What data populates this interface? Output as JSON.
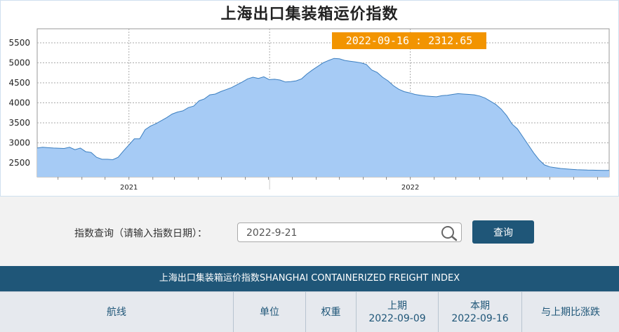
{
  "chart_data": {
    "type": "area",
    "title": "上海出口集装箱运价指数",
    "tooltip": "2022-09-16 : 2312.65",
    "y_ticks": [
      2500,
      3000,
      3500,
      4000,
      4500,
      5000,
      5500
    ],
    "ylim": [
      2150,
      5850
    ],
    "x_tick_labels": [
      "2021",
      "2022"
    ],
    "fill_color": "#a6cbf5",
    "line_color": "#3c7fc0",
    "tooltip_bg": "#f29400",
    "series": [
      {
        "x": [
          "2020-09-04",
          "2020-09-11",
          "2020-09-18",
          "2020-09-25",
          "2020-10-09",
          "2020-10-16",
          "2020-10-23",
          "2020-10-30",
          "2020-11-06",
          "2020-11-13",
          "2020-11-20",
          "2020-11-27",
          "2020-12-04",
          "2020-12-11",
          "2020-12-18",
          "2020-12-25",
          "2021-01-01",
          "2021-01-08",
          "2021-01-15",
          "2021-01-22",
          "2021-01-29",
          "2021-02-05",
          "2021-02-19",
          "2021-02-26",
          "2021-03-05",
          "2021-03-12",
          "2021-03-19",
          "2021-03-26",
          "2021-04-02",
          "2021-04-09",
          "2021-04-16",
          "2021-04-23",
          "2021-04-30",
          "2021-05-07",
          "2021-05-14",
          "2021-05-21",
          "2021-05-28",
          "2021-06-04",
          "2021-06-11",
          "2021-06-18",
          "2021-06-25",
          "2021-07-02",
          "2021-07-09",
          "2021-07-16",
          "2021-07-23",
          "2021-07-30",
          "2021-08-06",
          "2021-08-13",
          "2021-08-20",
          "2021-08-27",
          "2021-09-03",
          "2021-09-10",
          "2021-09-17",
          "2021-09-24",
          "2021-10-01",
          "2021-10-08",
          "2021-10-15",
          "2021-10-22",
          "2021-10-29",
          "2021-11-05",
          "2021-11-12",
          "2021-11-19",
          "2021-11-26",
          "2021-12-03",
          "2021-12-10",
          "2021-12-17",
          "2021-12-24",
          "2021-12-31",
          "2022-01-07",
          "2022-01-14",
          "2022-01-21",
          "2022-01-28",
          "2022-02-04",
          "2022-02-11",
          "2022-02-18",
          "2022-02-25",
          "2022-03-04",
          "2022-03-11",
          "2022-03-18",
          "2022-03-25",
          "2022-04-01",
          "2022-04-08",
          "2022-04-15",
          "2022-04-22",
          "2022-04-29",
          "2022-05-06",
          "2022-05-13",
          "2022-05-20",
          "2022-05-27",
          "2022-06-03",
          "2022-06-10",
          "2022-06-17",
          "2022-06-24",
          "2022-07-01",
          "2022-07-08",
          "2022-07-15",
          "2022-07-22",
          "2022-07-29",
          "2022-08-05",
          "2022-08-12",
          "2022-08-19",
          "2022-08-26",
          "2022-09-02",
          "2022-09-09",
          "2022-09-16"
        ],
        "values": [
          2870,
          2890,
          2880,
          2870,
          2860,
          2890,
          2830,
          2870,
          2780,
          2760,
          2640,
          2590,
          2590,
          2580,
          2640,
          2800,
          2950,
          3100,
          3100,
          3330,
          3420,
          3480,
          3630,
          3720,
          3770,
          3800,
          3880,
          3920,
          4050,
          4100,
          4200,
          4220,
          4280,
          4330,
          4380,
          4450,
          4520,
          4600,
          4640,
          4610,
          4650,
          4580,
          4590,
          4570,
          4520,
          4530,
          4550,
          4600,
          4720,
          4820,
          4910,
          5000,
          5060,
          5110,
          5100,
          5060,
          5040,
          5020,
          5000,
          4960,
          4820,
          4760,
          4640,
          4550,
          4430,
          4340,
          4280,
          4250,
          4210,
          4190,
          4170,
          4160,
          4150,
          4180,
          4190,
          4210,
          4230,
          4220,
          4210,
          4200,
          4170,
          4120,
          4040,
          3960,
          3840,
          3680,
          3470,
          3350,
          3150,
          2950,
          2750,
          2580,
          2450,
          2400,
          2380,
          2360,
          2350,
          2340,
          2330,
          2325,
          2320,
          2318,
          2315,
          2313,
          2312.65
        ]
      }
    ]
  },
  "query": {
    "label": "指数查询（请输入指数日期）：",
    "date_value": "2022-9-21",
    "button_label": "查询"
  },
  "table": {
    "title": "上海出口集装箱运价指数SHANGHAI CONTAINERIZED FREIGHT INDEX",
    "columns": [
      {
        "label": "航线"
      },
      {
        "label": "单位"
      },
      {
        "label": "权重"
      },
      {
        "label": "上期",
        "sub": "2022-09-09"
      },
      {
        "label": "本期",
        "sub": "2022-09-16"
      },
      {
        "label": "与上期比涨跌"
      }
    ]
  }
}
